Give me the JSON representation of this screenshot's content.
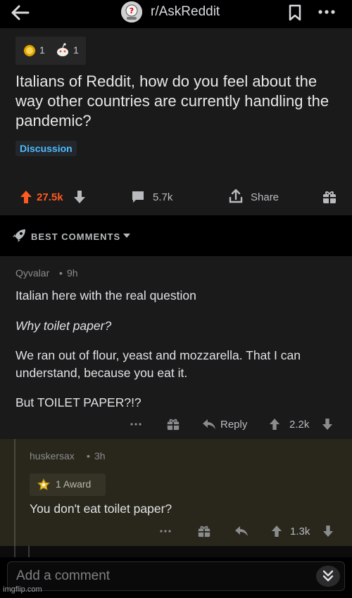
{
  "header": {
    "subreddit": "r/AskReddit",
    "icons": [
      "back-arrow-icon",
      "subreddit-avatar-icon",
      "bookmark-icon",
      "more-options-icon"
    ]
  },
  "post": {
    "award_counts": [
      "1",
      "1"
    ],
    "title": "Italians of Reddit, how do you feel about the way other countries are currently handling the pandemic?",
    "flair": "Discussion",
    "score": "27.5k",
    "comments": "5.7k",
    "share_label": "Share"
  },
  "sort": {
    "label": "BEST COMMENTS"
  },
  "comments": [
    {
      "author": "Qyvalar",
      "age": "9h",
      "paragraphs": [
        "Italian here with the real question",
        "Why toilet paper?",
        "We ran out of flour, yeast and mozzarella. That I can understand, because you eat it.",
        "But TOILET PAPER?!?"
      ],
      "reply_label": "Reply",
      "score": "2.2k"
    },
    {
      "author": "huskersax",
      "age": "3h",
      "award_label": "1 Award",
      "body": "You don't eat toilet paper?",
      "score": "1.3k"
    }
  ],
  "composer": {
    "placeholder": "Add a comment"
  },
  "watermark": "imgflip.com",
  "colors": {
    "upvote": "#ff5a1f",
    "flair": "#4fbcff",
    "post_bg": "#1a1a1b",
    "highlight_bg": "#29271c"
  }
}
